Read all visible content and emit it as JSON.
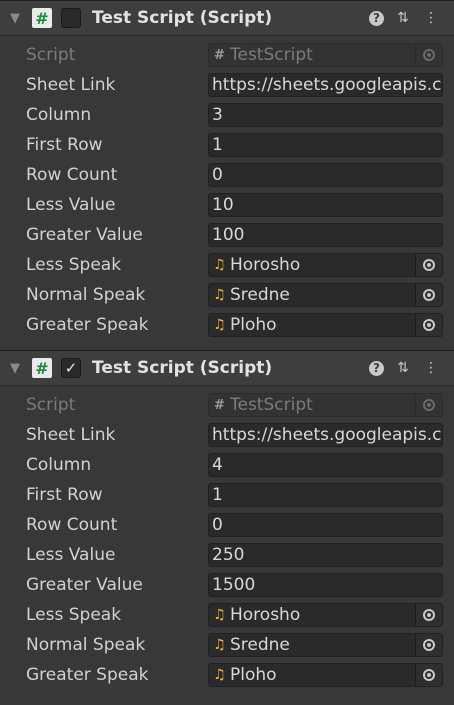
{
  "components": [
    {
      "title": "Test Script (Script)",
      "enabled": false,
      "script": "TestScript",
      "labels": {
        "script": "Script",
        "sheet_link": "Sheet Link",
        "column": "Column",
        "first_row": "First Row",
        "row_count": "Row Count",
        "less_value": "Less Value",
        "greater_value": "Greater Value",
        "less_speak": "Less Speak",
        "normal_speak": "Normal Speak",
        "greater_speak": "Greater Speak"
      },
      "values": {
        "sheet_link": "https://sheets.googleapis.com",
        "column": "3",
        "first_row": "1",
        "row_count": "0",
        "less_value": "10",
        "greater_value": "100",
        "less_speak": "Horosho",
        "normal_speak": "Sredne",
        "greater_speak": "Ploho"
      }
    },
    {
      "title": "Test Script (Script)",
      "enabled": true,
      "script": "TestScript",
      "labels": {
        "script": "Script",
        "sheet_link": "Sheet Link",
        "column": "Column",
        "first_row": "First Row",
        "row_count": "Row Count",
        "less_value": "Less Value",
        "greater_value": "Greater Value",
        "less_speak": "Less Speak",
        "normal_speak": "Normal Speak",
        "greater_speak": "Greater Speak"
      },
      "values": {
        "sheet_link": "https://sheets.googleapis.com",
        "column": "4",
        "first_row": "1",
        "row_count": "0",
        "less_value": "250",
        "greater_value": "1500",
        "less_speak": "Horosho",
        "normal_speak": "Sredne",
        "greater_speak": "Ploho"
      }
    }
  ],
  "icons": {
    "foldout": "triangle-down-icon",
    "script": "cs-script-icon",
    "help": "help-icon",
    "presets": "presets-sliders-icon",
    "menu": "kebab-menu-icon",
    "audio": "audio-clip-icon",
    "picker": "object-picker-icon"
  },
  "colors": {
    "background": "#383838",
    "header": "#3e3e3e",
    "field": "#2a2a2a",
    "audio_icon": "#f2b233",
    "script_icon_green": "#1b8a3a"
  }
}
